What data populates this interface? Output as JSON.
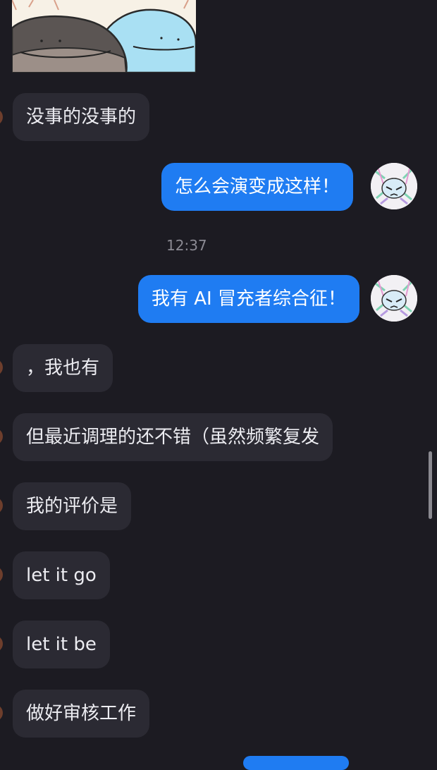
{
  "messages": {
    "m1": "没事的没事的",
    "m2": "怎么会演变成这样！",
    "time": "12:37",
    "m3": "我有 AI 冒充者综合征！",
    "m4": "，我也有",
    "m5": "但最近调理的还不错（虽然频繁复发",
    "m6": "我的评价是",
    "m7": "let it go",
    "m8": "let it be",
    "m9": "做好审核工作"
  },
  "colors": {
    "background": "#1c1b22",
    "incoming_bubble": "#2b2a33",
    "outgoing_bubble": "#1f7cf2"
  },
  "icons": {
    "sticker": "cartoon-sticker-two-round-creatures",
    "self_avatar": "anime-girl-avatar"
  }
}
